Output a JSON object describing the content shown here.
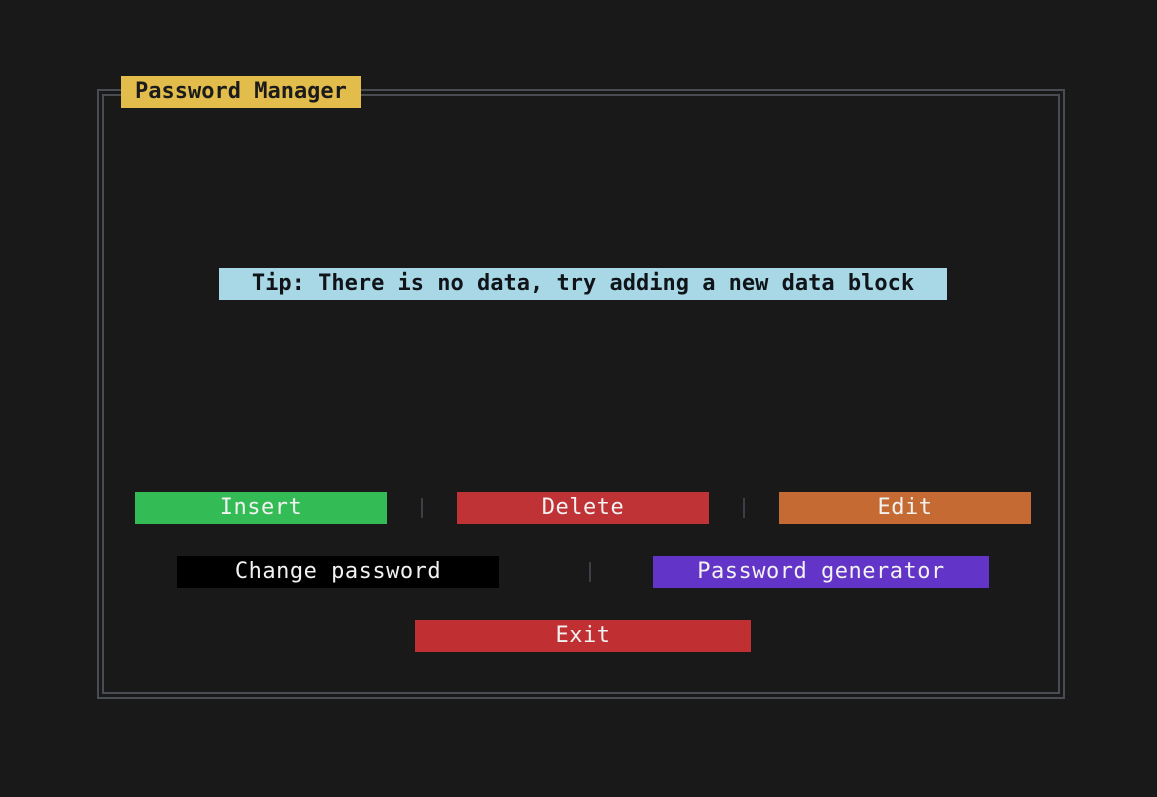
{
  "app": {
    "title": "Password Manager"
  },
  "main": {
    "tip_text": "Tip: There is no data, try adding a new data block"
  },
  "buttons": {
    "insert": {
      "label": "Insert",
      "color": "#33bb55"
    },
    "delete": {
      "label": "Delete",
      "color": "#bf3235"
    },
    "edit": {
      "label": "Edit",
      "color": "#c56a32"
    },
    "change_password": {
      "label": "Change password",
      "color": "#000000"
    },
    "password_generator": {
      "label": "Password generator",
      "color": "#6234c7"
    },
    "exit": {
      "label": "Exit",
      "color": "#c03033"
    }
  },
  "colors": {
    "background": "#191919",
    "frame_border": "#4a4c54",
    "title_tab": "#e2bd4b",
    "tip_background": "#a8d8e6"
  }
}
